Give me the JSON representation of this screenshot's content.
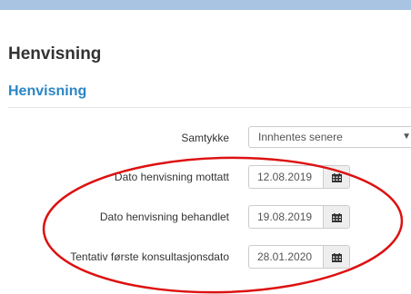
{
  "page": {
    "title": "Henvisning"
  },
  "section": {
    "title": "Henvisning"
  },
  "form": {
    "consent": {
      "label": "Samtykke",
      "selected": "Innhentes senere"
    },
    "fields": [
      {
        "label": "Dato henvisning mottatt",
        "value": "12.08.2019"
      },
      {
        "label": "Dato henvisning behandlet",
        "value": "19.08.2019"
      },
      {
        "label": "Tentativ første konsultasjonsdato",
        "value": "28.01.2020"
      }
    ]
  },
  "icons": {
    "calendar": "calendar-icon",
    "dropdown": "chevron-down-icon"
  },
  "colors": {
    "section_title": "#2a86c5",
    "top_bar": "#a9c4e2",
    "annotation": "#dd1111"
  }
}
